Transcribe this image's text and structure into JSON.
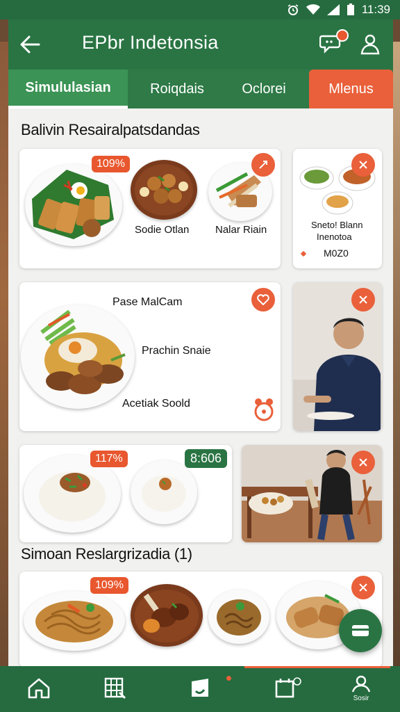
{
  "status_bar": {
    "time": "11:39"
  },
  "app_bar": {
    "title": "EPbr  Indetonsia"
  },
  "tabs": [
    {
      "label": "Simululasian",
      "active": true
    },
    {
      "label": "Roiqdais",
      "active": false
    },
    {
      "label": "Oclorei",
      "active": false
    },
    {
      "label": "Mlenus",
      "active": false
    }
  ],
  "sections": {
    "first_title": "Balivin Resairalpatsdandas",
    "second_title": "Simoan Reslargrizadia (1)"
  },
  "row1": {
    "main_card": {
      "badge": "109%",
      "dish2_label": "Sodie Otlan",
      "dish3_label": "Nalar Riain"
    },
    "side_card": {
      "label_line1": "Sneto! Blann",
      "label_line2": "Inenotoa",
      "price": "M0Z0"
    }
  },
  "row2": {
    "main_card": {
      "label1": "Pase MalCam",
      "label2": "Prachin Snaie",
      "label3": "Acetiak Soold"
    }
  },
  "row3": {
    "main_card": {
      "badge": "117%",
      "price_badge": "8:606"
    }
  },
  "row4": {
    "main_card": {
      "badge": "109%"
    }
  },
  "nav": {
    "items": [
      "home",
      "menu",
      "orders",
      "calendar",
      "profile"
    ],
    "profile_label": "Sosir"
  },
  "colors": {
    "primary": "#2a7443",
    "accent": "#e9603a"
  }
}
